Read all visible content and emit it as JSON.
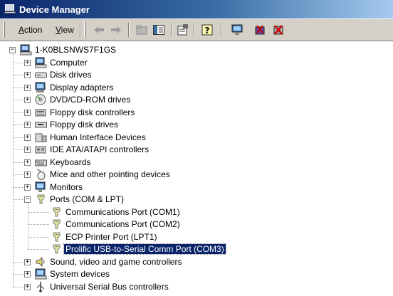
{
  "window": {
    "title": "Device Manager"
  },
  "menu": {
    "action_label": "Action",
    "action_mnemonic": "A",
    "action_rest": "ction",
    "view_label": "View",
    "view_mnemonic": "V",
    "view_rest": "iew"
  },
  "toolbar_icons": [
    "back-arrow-icon",
    "forward-arrow-icon",
    "up-folder-icon",
    "show-hide-tree-icon",
    "properties-icon",
    "help-icon",
    "scan-hardware-icon",
    "update-driver-icon",
    "uninstall-icon"
  ],
  "colors": {
    "titlebar_start": "#0a246a",
    "titlebar_end": "#a6caf0",
    "selection": "#0a246a",
    "chrome": "#d4d0c8"
  },
  "tree": {
    "root": {
      "label": "1-K0BLSNWS7F1GS",
      "icon": "computer-icon",
      "expanded": true
    },
    "categories": [
      {
        "label": "Computer",
        "icon": "computer-icon",
        "expanded": false
      },
      {
        "label": "Disk drives",
        "icon": "disk-drive-icon",
        "expanded": false
      },
      {
        "label": "Display adapters",
        "icon": "display-adapter-icon",
        "expanded": false
      },
      {
        "label": "DVD/CD-ROM drives",
        "icon": "cdrom-icon",
        "expanded": false
      },
      {
        "label": "Floppy disk controllers",
        "icon": "controller-icon",
        "expanded": false
      },
      {
        "label": "Floppy disk drives",
        "icon": "floppy-drive-icon",
        "expanded": false
      },
      {
        "label": "Human Interface Devices",
        "icon": "hid-icon",
        "expanded": false
      },
      {
        "label": "IDE ATA/ATAPI controllers",
        "icon": "ide-controller-icon",
        "expanded": false
      },
      {
        "label": "Keyboards",
        "icon": "keyboard-icon",
        "expanded": false
      },
      {
        "label": "Mice and other pointing devices",
        "icon": "mouse-icon",
        "expanded": false
      },
      {
        "label": "Monitors",
        "icon": "monitor-icon",
        "expanded": false
      },
      {
        "label": "Ports (COM & LPT)",
        "icon": "port-icon",
        "expanded": true,
        "children": [
          {
            "label": "Communications Port (COM1)",
            "icon": "port-icon",
            "selected": false
          },
          {
            "label": "Communications Port (COM2)",
            "icon": "port-icon",
            "selected": false
          },
          {
            "label": "ECP Printer Port (LPT1)",
            "icon": "port-icon",
            "selected": false
          },
          {
            "label": "Prolific USB-to-Serial Comm Port (COM3)",
            "icon": "port-icon",
            "selected": true
          }
        ]
      },
      {
        "label": "Sound, video and game controllers",
        "icon": "speaker-icon",
        "expanded": false
      },
      {
        "label": "System devices",
        "icon": "system-devices-icon",
        "expanded": false
      },
      {
        "label": "Universal Serial Bus controllers",
        "icon": "usb-icon",
        "expanded": false
      }
    ]
  }
}
